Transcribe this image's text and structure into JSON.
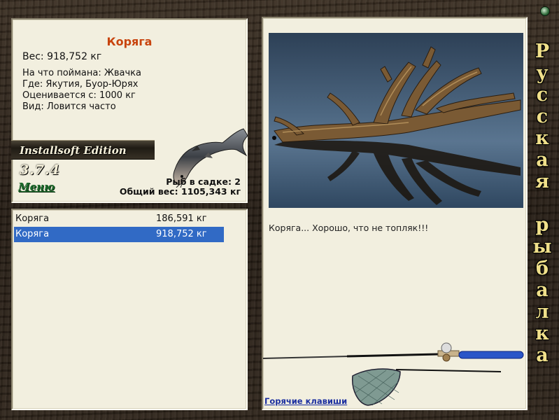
{
  "fish": {
    "name": "Коряга",
    "weight_line": "Вес: 918,752 кг",
    "caught_on": "На что поймана: Жвачка",
    "where": "Где: Якутия, Буор-Юрях",
    "value": "Оценивается с: 1000 кг",
    "kind": "Вид: Ловится часто"
  },
  "logo": {
    "text": "Installsoft Edition",
    "version": "3.7.4"
  },
  "menu_label": "Меню",
  "stats": {
    "in_cage": "Рыб в садке: 2",
    "total_weight": "Общий вес: 1105,343 кг"
  },
  "catch_list": [
    {
      "name": "Коряга",
      "weight": "186,591 кг",
      "selected": false
    },
    {
      "name": "Коряга",
      "weight": "918,752 кг",
      "selected": true
    }
  ],
  "caption": "Коряга... Хорошо, что не топляк!!!",
  "hotkeys_label": "Горячие клавиши",
  "side_title": [
    "Р",
    "у",
    "с",
    "с",
    "к",
    "а",
    "я",
    "",
    "р",
    "ы",
    "б",
    "а",
    "л",
    "к",
    "а"
  ],
  "colors": {
    "accent_name": "#c8440e",
    "selection": "#316ac5",
    "panel": "#f2efdf"
  }
}
